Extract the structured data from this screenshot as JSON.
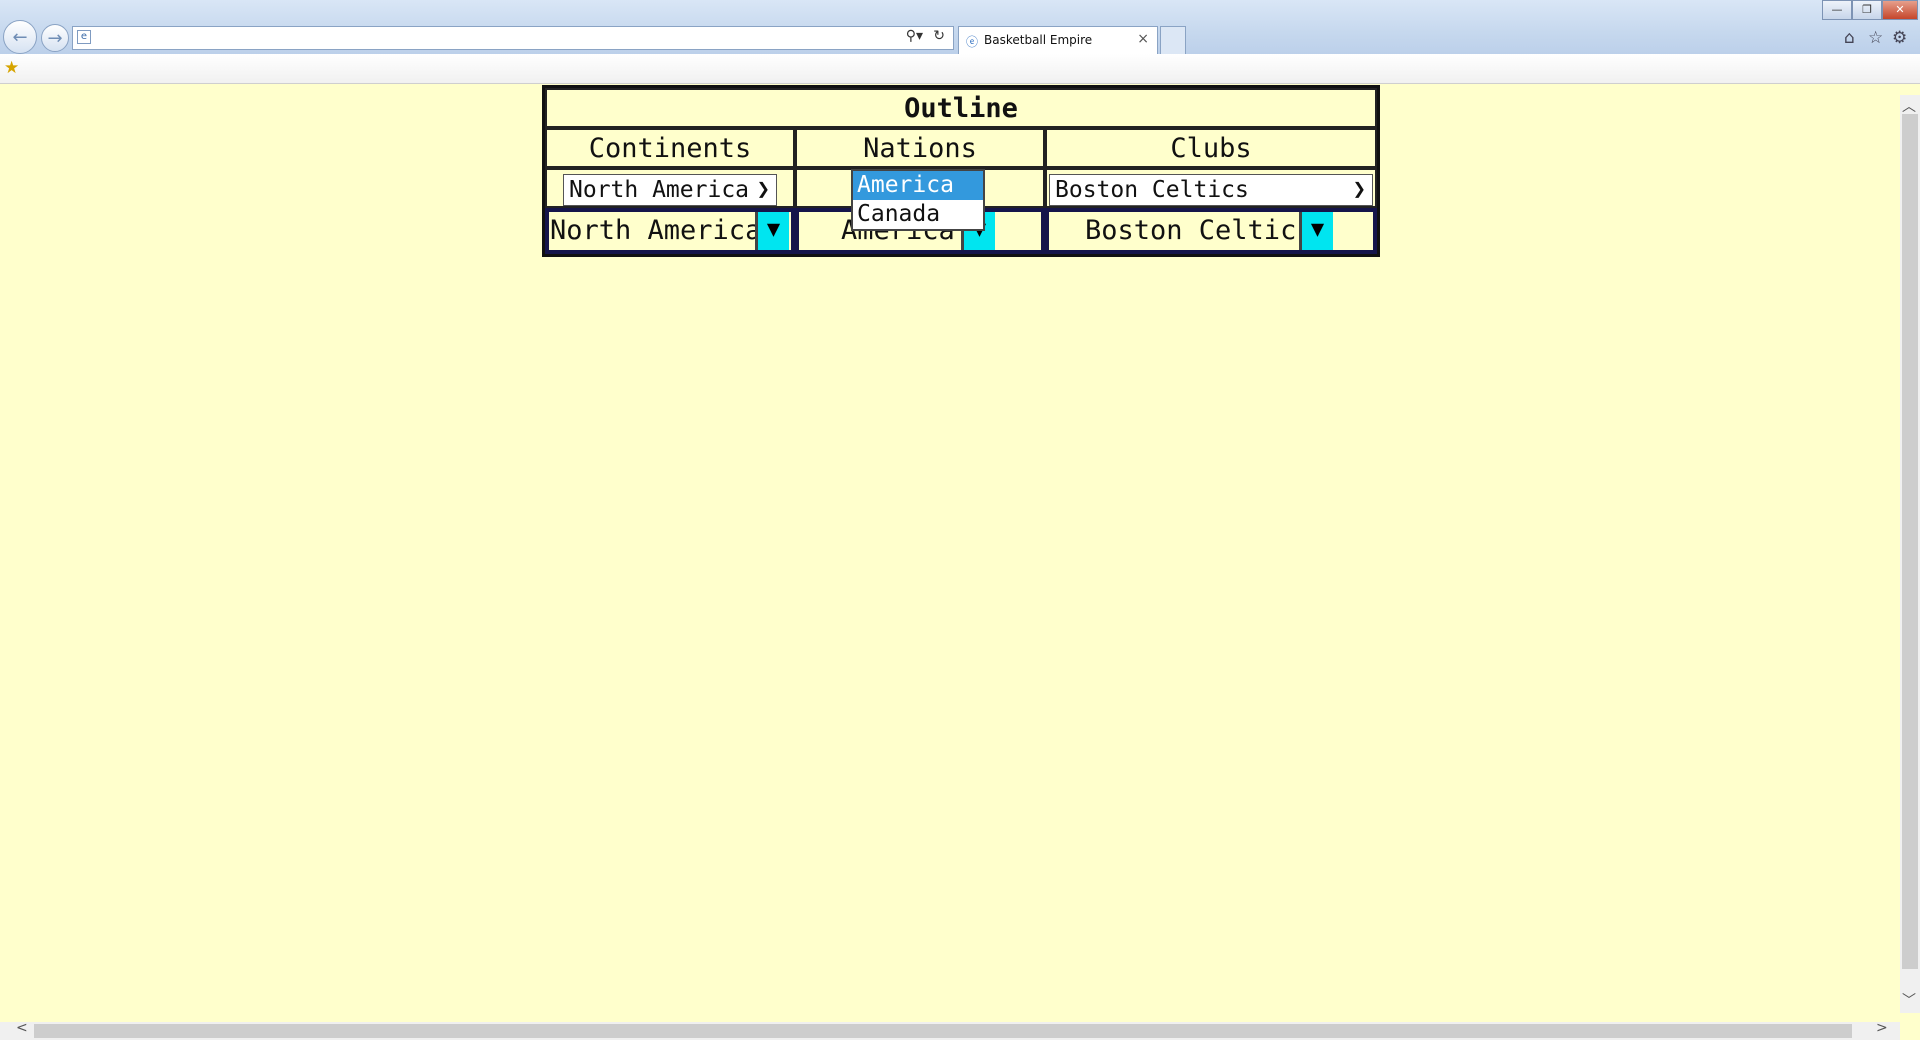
{
  "browser": {
    "tab_title": "Basketball Empire",
    "address_value": "",
    "icons": {
      "back": "back-arrow-icon",
      "forward": "forward-arrow-icon",
      "search": "search-icon",
      "refresh": "refresh-icon",
      "close_tab": "close-icon",
      "home": "home-icon",
      "favorites": "star-icon",
      "tools": "gear-icon",
      "add_favorites": "favorites-add-icon"
    }
  },
  "outline": {
    "title": "Outline",
    "headers": {
      "continents": "Continents",
      "nations": "Nations",
      "clubs": "Clubs"
    },
    "native_selects": {
      "continent": "North America",
      "club": "Boston Celtics"
    },
    "custom_selects": {
      "continent": "North America",
      "nation": "America",
      "club": "Boston Celtics"
    },
    "nation_dropdown": {
      "options": [
        "America",
        "Canada"
      ],
      "highlighted": "America"
    }
  },
  "colors": {
    "page_background": "#ffffcc",
    "highlight": "#3399dd",
    "custom_button": "#00e5f0"
  }
}
